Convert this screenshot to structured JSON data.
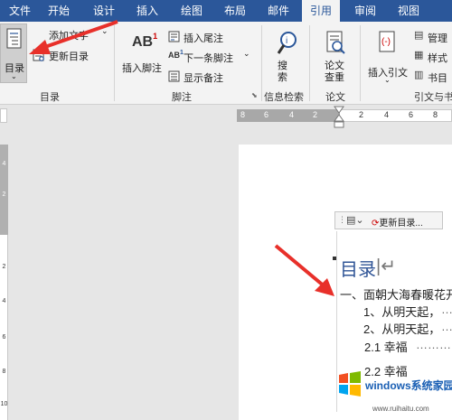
{
  "tabs": [
    {
      "label": "文件",
      "active": false
    },
    {
      "label": "开始",
      "active": false
    },
    {
      "label": "设计",
      "active": false
    },
    {
      "label": "插入",
      "active": false
    },
    {
      "label": "绘图",
      "active": false
    },
    {
      "label": "布局",
      "active": false
    },
    {
      "label": "邮件",
      "active": false
    },
    {
      "label": "引用",
      "active": true
    },
    {
      "label": "审阅",
      "active": false
    },
    {
      "label": "视图",
      "active": false
    }
  ],
  "ribbon": {
    "toc": {
      "toc_button": "目录",
      "add_text": "添加文字",
      "update_toc": "更新目录",
      "group_label": "目录"
    },
    "footnotes": {
      "insert_footnote": "插入脚注",
      "insert_endnote": "插入尾注",
      "next_footnote": "下一条脚注",
      "show_notes": "显示备注",
      "group_label": "脚注",
      "ab_icon_text": "AB",
      "ab_superscript": "1"
    },
    "research": {
      "search": "搜索",
      "group_label": "信息检索"
    },
    "paper": {
      "paper_check": "论文查重",
      "group_label": "论文"
    },
    "citations": {
      "insert_citation": "插入引文",
      "manage": "管理",
      "style": "样式",
      "bibliography": "书目",
      "group_label": "引文与书"
    }
  },
  "ruler": {
    "h_numbers": [
      "8",
      "6",
      "4",
      "2",
      "2",
      "4",
      "6",
      "8"
    ],
    "v_numbers": [
      "4",
      "2",
      "2",
      "4",
      "6",
      "8",
      "10"
    ]
  },
  "document": {
    "minibar_label": "更新目录...",
    "toc_heading": "目录",
    "lines": [
      "一、面朝大海春暖花开",
      "1、从明天起，",
      "2、从明天起，",
      "2.1  幸福",
      "2.2  幸福"
    ]
  },
  "watermark": {
    "brand": "windows系统家园",
    "url": "www.ruihaitu.com"
  },
  "colors": {
    "accent": "#2b579a",
    "arrow": "#e8302a",
    "heading": "#2f5496"
  }
}
